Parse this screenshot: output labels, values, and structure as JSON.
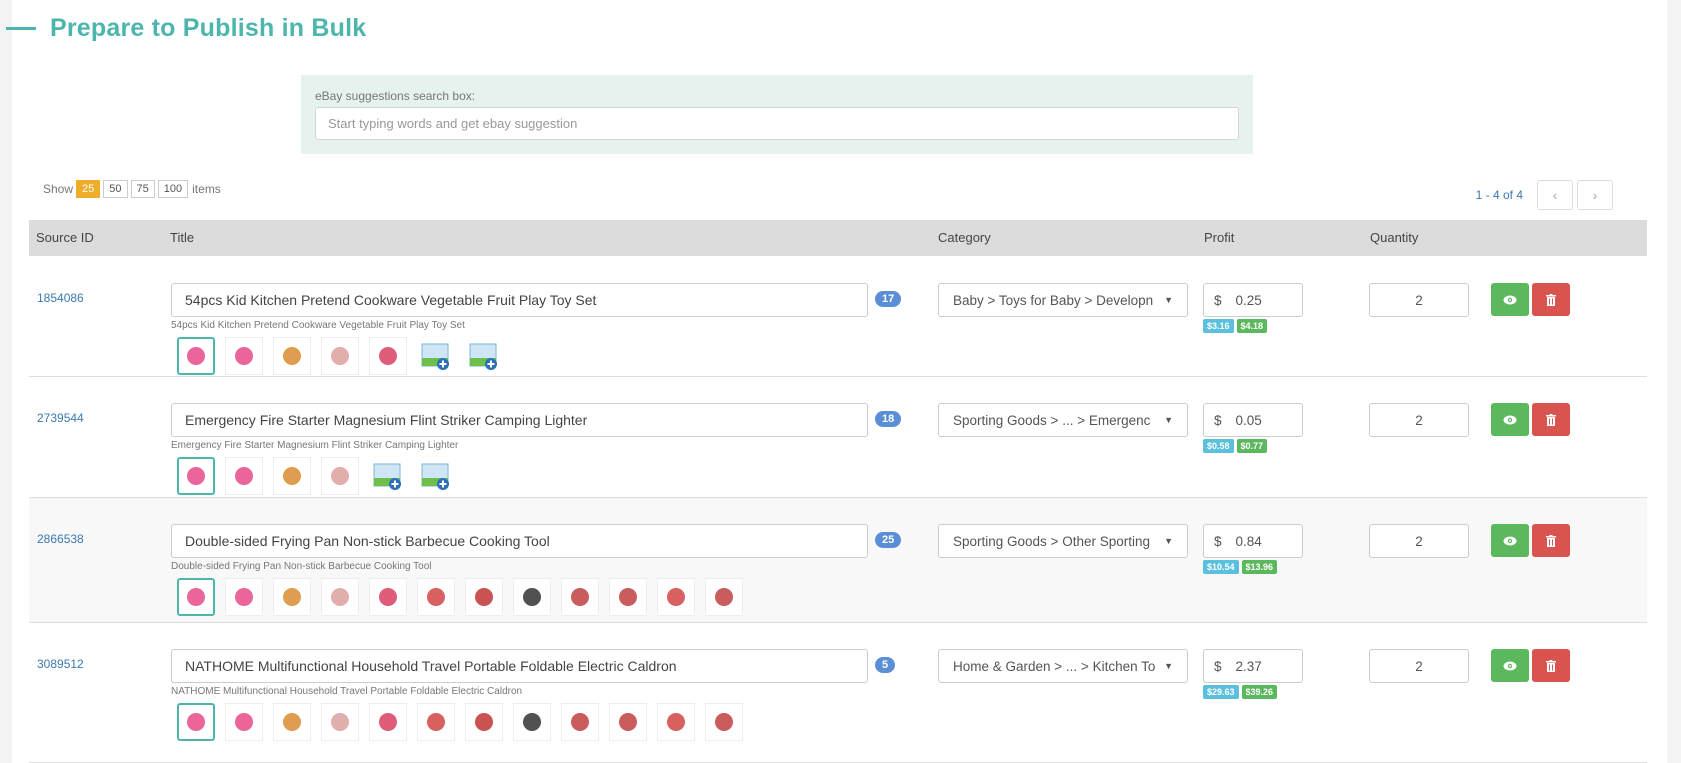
{
  "header": {
    "title": "Prepare to Publish in Bulk"
  },
  "suggestions": {
    "label": "eBay suggestions search box:",
    "placeholder": "Start typing words and get ebay suggestion",
    "value": ""
  },
  "page_size": {
    "show_label": "Show",
    "options": [
      "25",
      "50",
      "75",
      "100"
    ],
    "selected": "25",
    "items_label": "items"
  },
  "pagination": {
    "range_text": "1 - 4 of 4",
    "prev_icon": "‹",
    "next_icon": "›"
  },
  "table": {
    "headers": {
      "source_id": "Source ID",
      "title": "Title",
      "category": "Category",
      "profit": "Profit",
      "quantity": "Quantity"
    },
    "currency_symbol": "$",
    "rows": [
      {
        "source_id": "1854086",
        "title": "54pcs Kid Kitchen Pretend Cookware Vegetable Fruit Play Toy Set",
        "subtitle": "54pcs Kid Kitchen Pretend Cookware Vegetable Fruit Play Toy Set",
        "char_count": "17",
        "category": "Baby > Toys for Baby > Developn",
        "profit": "0.25",
        "price_tags": [
          "$3.16",
          "$4.18"
        ],
        "quantity": "2",
        "thumbnails": 5,
        "add_image_slots": 2
      },
      {
        "source_id": "2739544",
        "title": "Emergency Fire Starter Magnesium Flint Striker Camping Lighter",
        "subtitle": "Emergency Fire Starter Magnesium Flint Striker Camping Lighter",
        "char_count": "18",
        "category": "Sporting Goods > ... > Emergenc",
        "profit": "0.05",
        "price_tags": [
          "$0.58",
          "$0.77"
        ],
        "quantity": "2",
        "thumbnails": 4,
        "add_image_slots": 2
      },
      {
        "source_id": "2866538",
        "title": "Double-sided Frying Pan Non-stick Barbecue Cooking Tool",
        "subtitle": "Double-sided Frying Pan Non-stick Barbecue Cooking Tool",
        "char_count": "25",
        "category": "Sporting Goods > Other Sporting",
        "profit": "0.84",
        "price_tags": [
          "$10.54",
          "$13.96"
        ],
        "quantity": "2",
        "thumbnails": 12,
        "add_image_slots": 0
      },
      {
        "source_id": "3089512",
        "title": "NATHOME Multifunctional Household Travel Portable Foldable Electric Caldron",
        "subtitle": "NATHOME Multifunctional Household Travel Portable Foldable Electric Caldron",
        "char_count": "5",
        "category": "Home & Garden > ... > Kitchen To",
        "profit": "2.37",
        "price_tags": [
          "$29.63",
          "$39.26"
        ],
        "quantity": "2",
        "thumbnails": 12,
        "add_image_slots": 0
      }
    ]
  },
  "colors": {
    "accent": "#4db6ac",
    "page_size_active": "#f0ad2a",
    "count_badge": "#5a8fd6",
    "tag_blue": "#5bc0de",
    "tag_green": "#5cb85c",
    "view_button": "#5cb85c",
    "delete_button": "#d9534f"
  }
}
